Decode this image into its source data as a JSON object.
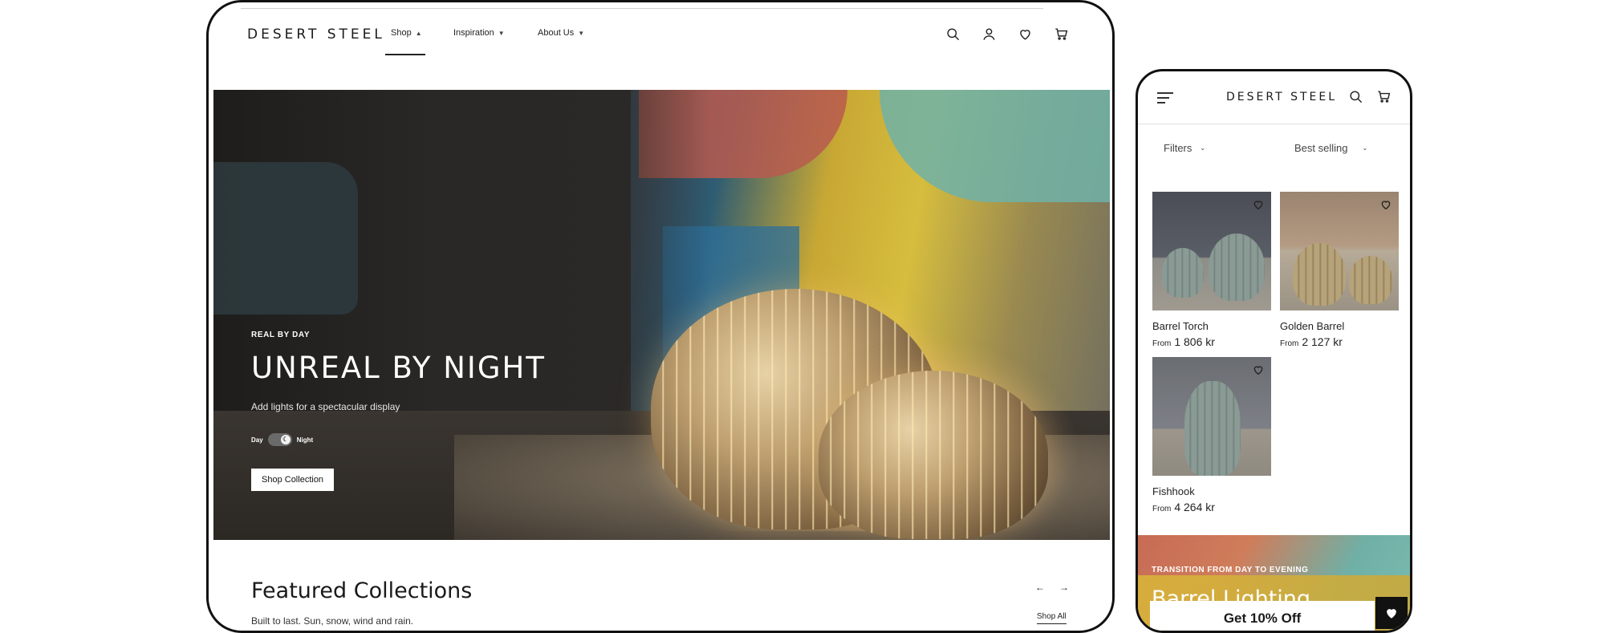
{
  "brand": "DESERT STEEL",
  "desktop": {
    "nav": [
      {
        "label": "Shop",
        "chevron": "chevron-up-icon"
      },
      {
        "label": "Inspiration",
        "chevron": "chevron-down-icon"
      },
      {
        "label": "About Us",
        "chevron": "chevron-down-icon"
      }
    ],
    "header_icons": [
      "search-icon",
      "account-icon",
      "heart-icon",
      "cart-icon"
    ],
    "hero": {
      "eyebrow": "REAL BY DAY",
      "title": "UNREAL BY NIGHT",
      "subtitle": "Add lights for a spectacular display",
      "toggle": {
        "left": "Day",
        "right": "Night",
        "state": "night"
      },
      "cta": "Shop Collection"
    },
    "featured": {
      "title": "Featured Collections",
      "subtitle": "Built to last. Sun, snow, wind and rain.",
      "prev": "←",
      "next": "→",
      "link": "Shop All"
    }
  },
  "mobile": {
    "filters_label": "Filters",
    "sort_label": "Best selling",
    "products": [
      {
        "name": "Barrel Torch",
        "from": "From",
        "price": "1 806 kr"
      },
      {
        "name": "Golden Barrel",
        "from": "From",
        "price": "2 127 kr"
      },
      {
        "name": "Fishhook",
        "from": "From",
        "price": "4 264 kr"
      }
    ],
    "banner": {
      "eyebrow": "TRANSITION FROM DAY TO EVENING",
      "title": "Barrel Lighting"
    },
    "discount": "Get 10% Off"
  },
  "colors": {
    "text": "#1a1a1a",
    "button_bg": "#ffffff",
    "dark": "#111111"
  }
}
